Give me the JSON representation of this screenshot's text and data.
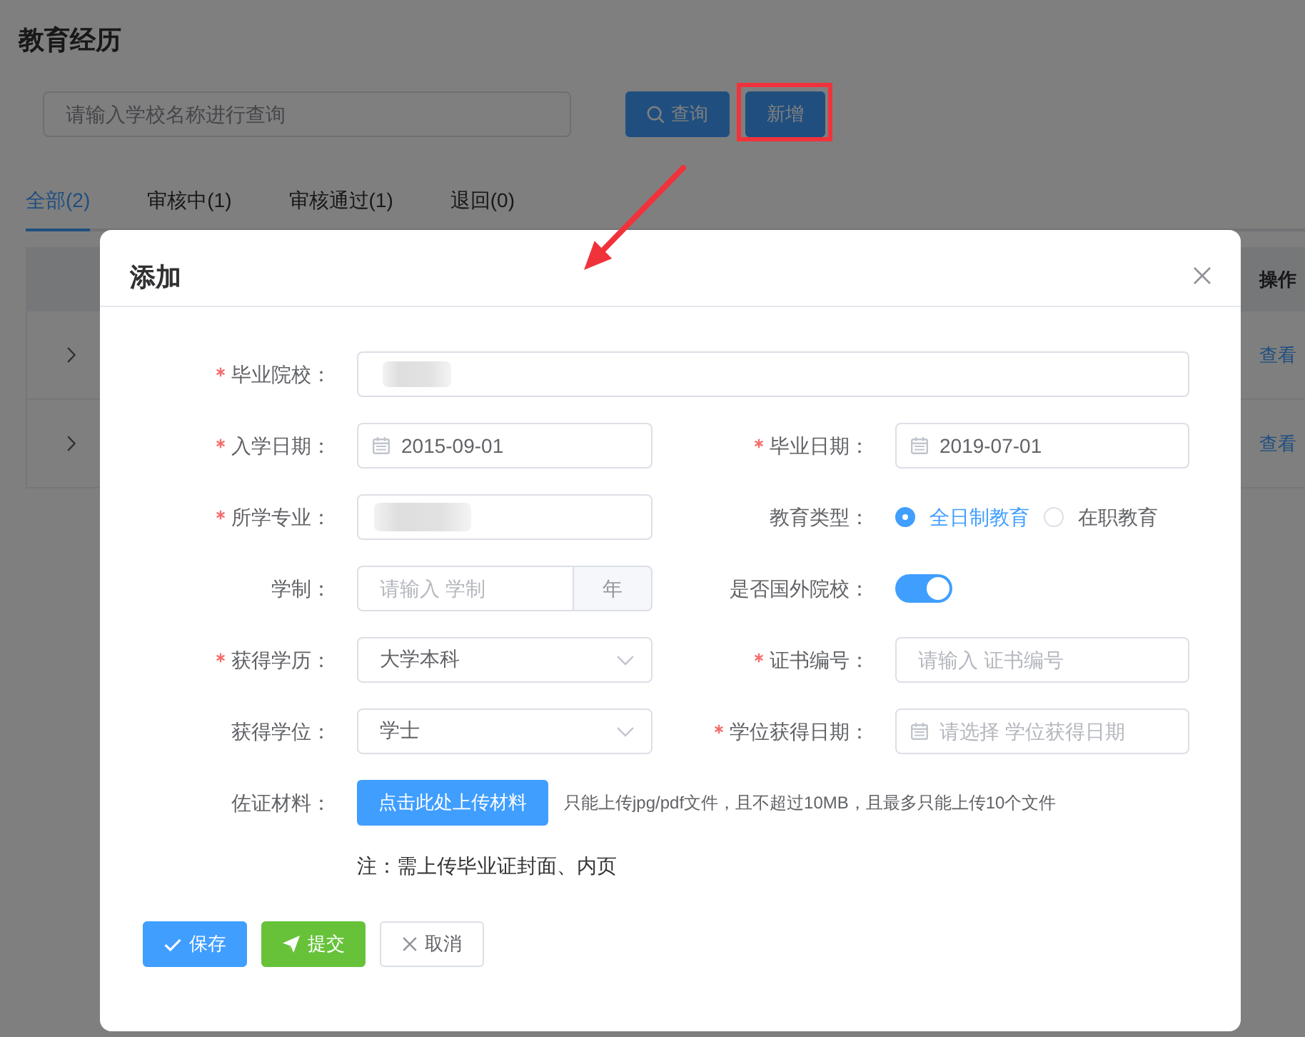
{
  "page": {
    "title": "教育经历",
    "search": {
      "placeholder": "请输入学校名称进行查询"
    },
    "buttons": [
      {
        "kind": "search",
        "label": "查询",
        "highlighted": false
      },
      {
        "kind": "add",
        "label": "新增",
        "highlighted": true
      }
    ],
    "tabs": [
      {
        "label": "全部(2)",
        "selected": true
      },
      {
        "label": "审核中(1)",
        "selected": false
      },
      {
        "label": "审核通过(1)",
        "selected": false
      },
      {
        "label": "退回(0)",
        "selected": false
      }
    ],
    "table": {
      "action_column": "操作",
      "rows": [
        {
          "expanded": false,
          "action": "查看"
        },
        {
          "expanded": false,
          "action": "查看"
        }
      ]
    }
  },
  "dialog": {
    "title": "添加",
    "rows": [
      [
        {
          "kind": "text",
          "label": "毕业院校：",
          "required": true,
          "redacted": true
        }
      ],
      [
        {
          "kind": "date",
          "label": "入学日期：",
          "required": true,
          "value": "2015-09-01"
        },
        {
          "kind": "date",
          "label": "毕业日期：",
          "required": true,
          "value": "2019-07-01"
        }
      ],
      [
        {
          "kind": "text",
          "label": "所学专业：",
          "required": true,
          "redacted": true
        },
        {
          "kind": "radio",
          "label": "教育类型：",
          "required": false,
          "options": [
            {
              "label": "全日制教育",
              "selected": true
            },
            {
              "label": "在职教育",
              "selected": false
            }
          ]
        }
      ],
      [
        {
          "kind": "addon",
          "label": "学制：",
          "required": false,
          "placeholder": "请输入 学制",
          "append": "年"
        },
        {
          "kind": "switch",
          "label": "是否国外院校：",
          "required": false,
          "on": true
        }
      ],
      [
        {
          "kind": "select",
          "label": "获得学历：",
          "required": true,
          "value": "大学本科"
        },
        {
          "kind": "text",
          "label": "证书编号：",
          "required": true,
          "placeholder": "请输入 证书编号"
        }
      ],
      [
        {
          "kind": "select",
          "label": "获得学位：",
          "required": false,
          "value": "学士"
        },
        {
          "kind": "date",
          "label": "学位获得日期：",
          "required": true,
          "placeholder": "请选择 学位获得日期"
        }
      ],
      [
        {
          "kind": "upload",
          "label": "佐证材料：",
          "required": false,
          "button": "点击此处上传材料",
          "hint": "只能上传jpg/pdf文件，且不超过10MB，且最多只能上传10个文件"
        }
      ]
    ],
    "note": "注：需上传毕业证封面、内页",
    "buttons": [
      {
        "kind": "save",
        "label": "保存"
      },
      {
        "kind": "submit",
        "label": "提交"
      },
      {
        "kind": "cancel",
        "label": "取消"
      }
    ]
  }
}
